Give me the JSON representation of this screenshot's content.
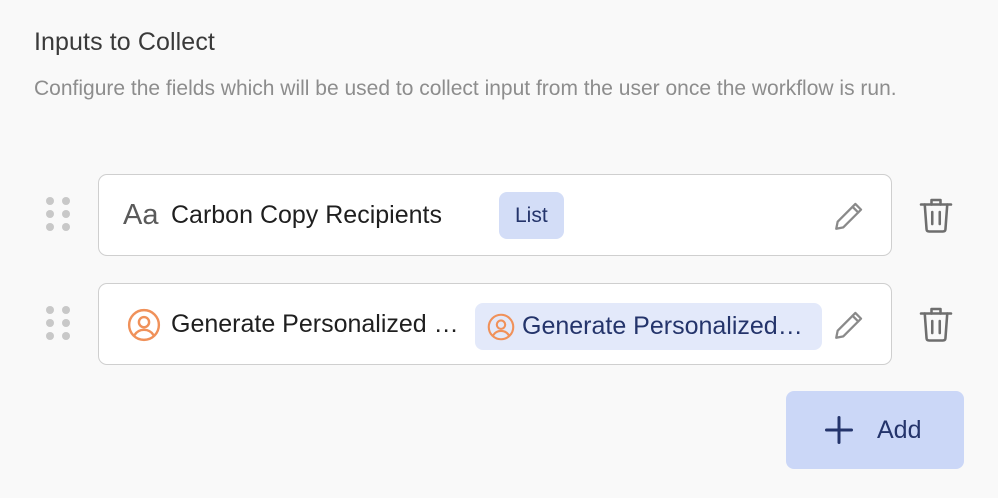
{
  "section": {
    "title": "Inputs to Collect",
    "description": "Configure the fields which will be used to collect input from the user once the workflow is run."
  },
  "fields": [
    {
      "type_icon": "text-type-icon",
      "type_glyph": "Aa",
      "name": "Carbon Copy Recipients",
      "badge": "List"
    },
    {
      "type_icon": "person-circle-icon",
      "name": "Generate Personalized Email",
      "badge": "Generate Personalized Email",
      "badge_icon": "person-circle-icon"
    }
  ],
  "actions": {
    "edit_icon": "pencil-icon",
    "delete_icon": "trash-icon",
    "add_label": "Add",
    "add_icon": "plus-icon"
  },
  "colors": {
    "accent": "#cbd7f7",
    "accent_text": "#24346b",
    "person_icon": "#f0915a"
  }
}
